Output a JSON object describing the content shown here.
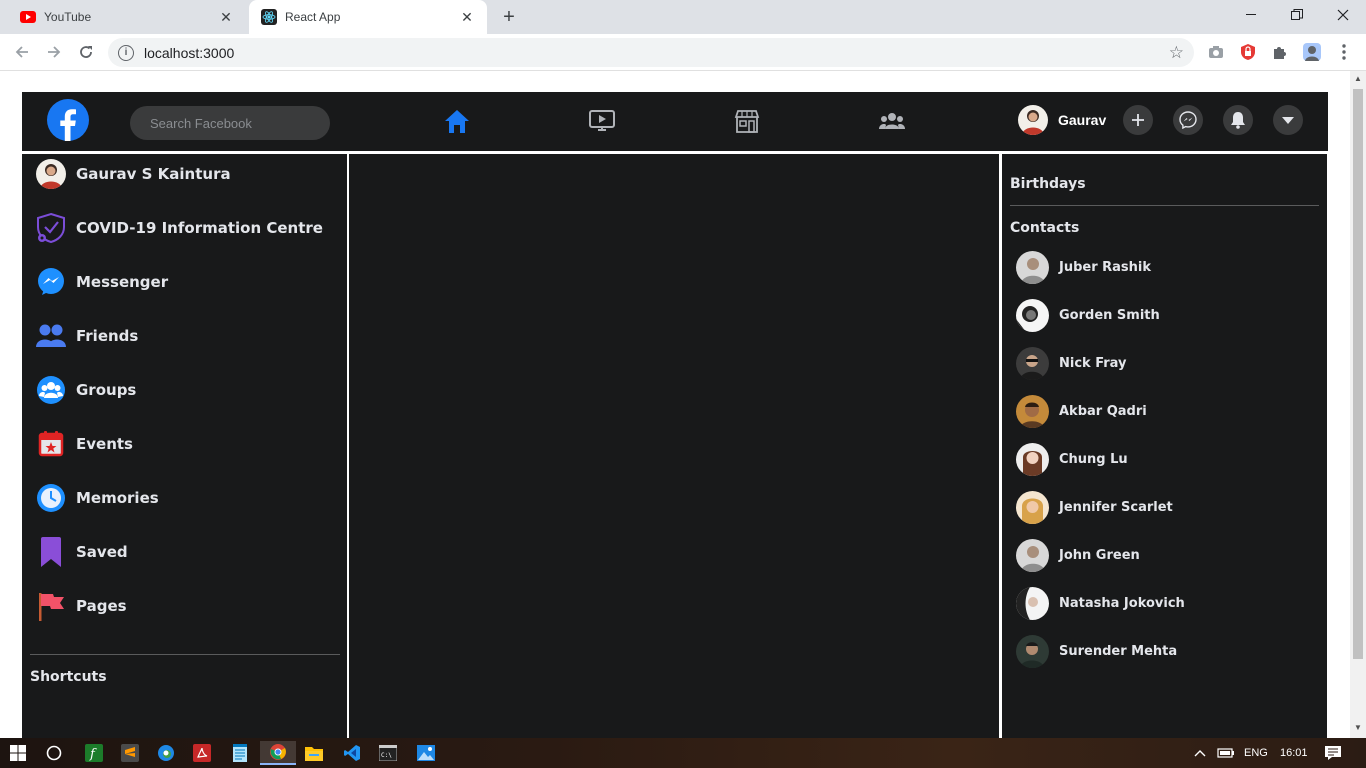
{
  "browser": {
    "tabs": [
      {
        "title": "YouTube",
        "active": false
      },
      {
        "title": "React App",
        "active": true
      }
    ],
    "url": "localhost:3000"
  },
  "header": {
    "search_placeholder": "Search Facebook",
    "user_name": "Gaurav",
    "nav_icons": [
      "home-icon",
      "watch-icon",
      "marketplace-icon",
      "groups-icon"
    ],
    "accent": "#1877f2"
  },
  "sidebar": {
    "items": [
      {
        "label": "Gaurav S Kaintura",
        "icon": "avatar"
      },
      {
        "label": "COVID-19 Information Centre",
        "icon": "shield-icon"
      },
      {
        "label": "Messenger",
        "icon": "messenger-icon"
      },
      {
        "label": "Friends",
        "icon": "friends-icon"
      },
      {
        "label": "Groups",
        "icon": "groups-icon"
      },
      {
        "label": "Events",
        "icon": "calendar-icon"
      },
      {
        "label": "Memories",
        "icon": "clock-icon"
      },
      {
        "label": "Saved",
        "icon": "bookmark-icon"
      },
      {
        "label": "Pages",
        "icon": "flag-icon"
      }
    ],
    "shortcuts_label": "Shortcuts"
  },
  "right": {
    "birthdays_label": "Birthdays",
    "contacts_label": "Contacts",
    "contacts": [
      "Juber Rashik",
      "Gorden Smith",
      "Nick Fray",
      "Akbar Qadri",
      "Chung Lu",
      "Jennifer Scarlet",
      "John Green",
      "Natasha Jokovich",
      "Surender Mehta"
    ]
  },
  "taskbar": {
    "language": "ENG",
    "time": "16:01"
  }
}
